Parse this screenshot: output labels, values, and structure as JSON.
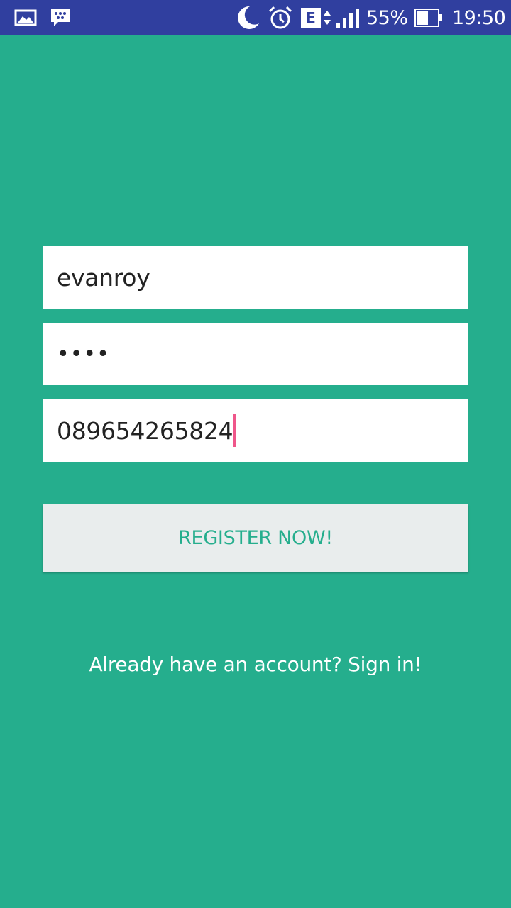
{
  "status_bar": {
    "battery": "55%",
    "time": "19:50",
    "network_type": "E",
    "icons": [
      "gallery-icon",
      "bbm-icon",
      "do-not-disturb-moon-icon",
      "alarm-icon",
      "network-edge-icon",
      "signal-icon",
      "battery-icon"
    ]
  },
  "form": {
    "username_value": "evanroy",
    "password_value": "••••",
    "phone_value": "089654265824"
  },
  "actions": {
    "register_label": "REGISTER NOW!",
    "signin_label": "Already have an account? Sign in!"
  },
  "colors": {
    "background": "#25AE8D",
    "status_bar": "#303F9F",
    "button_bg": "#E9EDED",
    "button_text": "#25AE8D",
    "caret": "#E91E63"
  }
}
